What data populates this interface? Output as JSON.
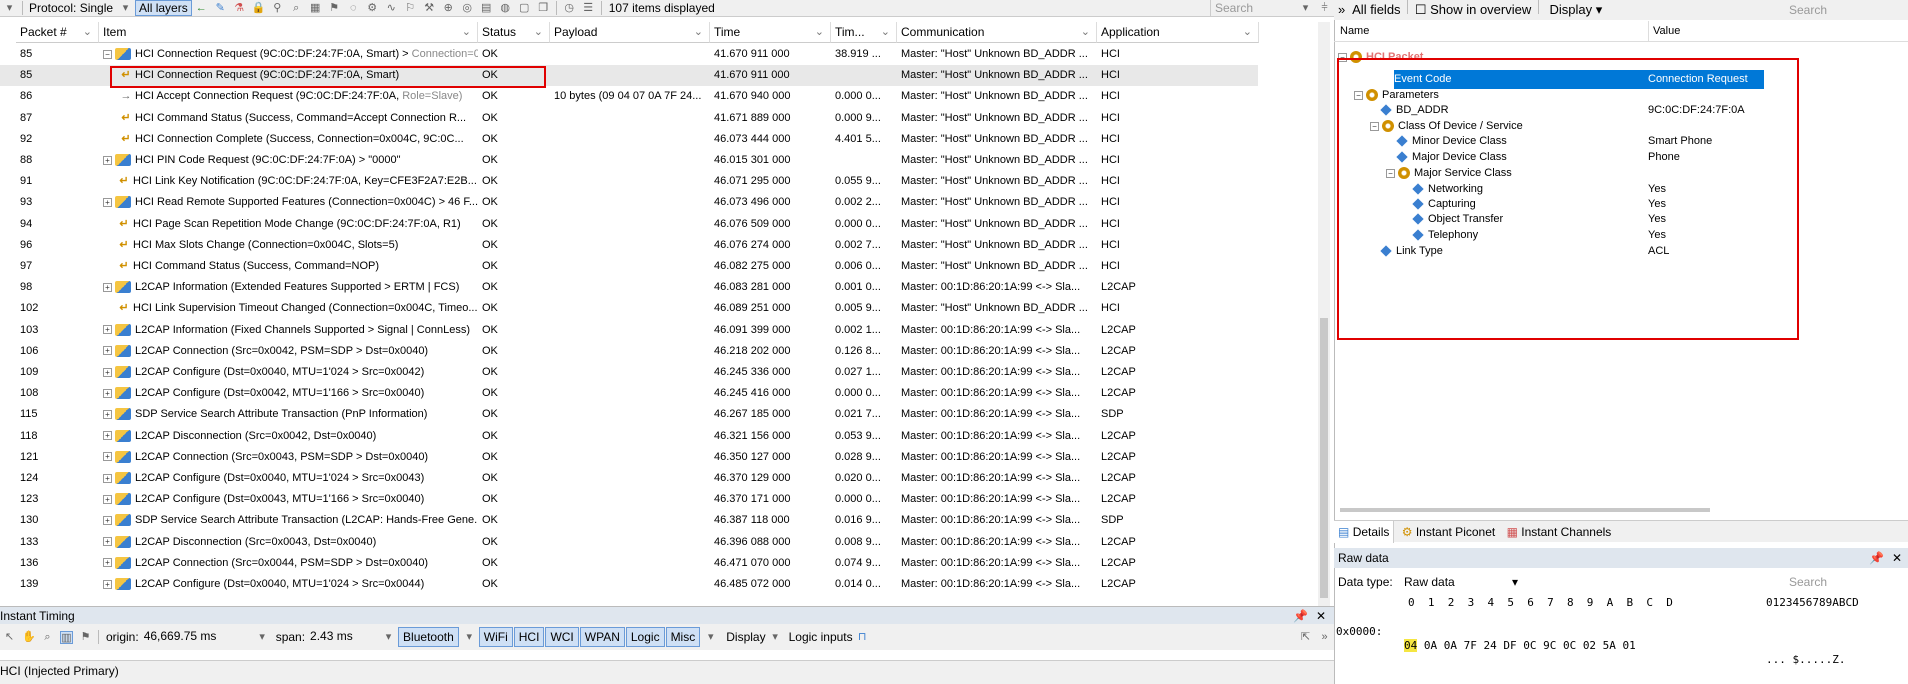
{
  "toolbar": {
    "protocol_label": "Protocol: Single",
    "layers_label": "All layers",
    "items_displayed": "107 items displayed",
    "search_placeholder": "Search"
  },
  "columns": [
    "Packet #",
    "Item",
    "Status",
    "Payload",
    "Time",
    "Tim...",
    "Communication",
    "Application"
  ],
  "rows": [
    {
      "packet": "85",
      "exp": "⊟",
      "icon": "l2",
      "text": "HCI Connection Request (9C:0C:DF:24:7F:0A, Smart) > ",
      "gray": "Connection=0...",
      "status": "OK",
      "payload": "",
      "time": "41.670 911 000",
      "tim": "38.919 ...",
      "comm": "Master: \"Host\" Unknown BD_ADDR ...",
      "app": "HCI",
      "indent": 0
    },
    {
      "packet": "85",
      "exp": "",
      "icon": "rev",
      "text": "HCI Connection Request (9C:0C:DF:24:7F:0A, Smart)",
      "gray": "",
      "status": "OK",
      "payload": "",
      "time": "41.670 911 000",
      "tim": "",
      "comm": "Master: \"Host\" Unknown BD_ADDR ...",
      "app": "HCI",
      "indent": 1
    },
    {
      "packet": "86",
      "exp": "",
      "icon": "fwd",
      "text": "HCI Accept Connection Request (9C:0C:DF:24:7F:0A, ",
      "gray": "Role=Slave)",
      "status": "OK",
      "payload": "10 bytes (09 04 07 0A 7F 24...",
      "time": "41.670 940 000",
      "tim": "0.000 0...",
      "comm": "Master: \"Host\" Unknown BD_ADDR ...",
      "app": "HCI",
      "indent": 1
    },
    {
      "packet": "87",
      "exp": "",
      "icon": "rev",
      "text": "HCI Command Status (Success, Command=Accept Connection R...",
      "gray": "",
      "status": "OK",
      "payload": "",
      "time": "41.671 889 000",
      "tim": "0.000 9...",
      "comm": "Master: \"Host\" Unknown BD_ADDR ...",
      "app": "HCI",
      "indent": 1
    },
    {
      "packet": "92",
      "exp": "",
      "icon": "rev",
      "text": "HCI Connection Complete (Success, Connection=0x004C, 9C:0C...",
      "gray": "",
      "status": "OK",
      "payload": "",
      "time": "46.073 444 000",
      "tim": "4.401 5...",
      "comm": "Master: \"Host\" Unknown BD_ADDR ...",
      "app": "HCI",
      "indent": 1
    },
    {
      "packet": "88",
      "exp": "⊞",
      "icon": "l2",
      "text": "HCI PIN Code Request (9C:0C:DF:24:7F:0A) > \"0000\"",
      "gray": "",
      "status": "OK",
      "payload": "",
      "time": "46.015 301 000",
      "tim": "",
      "comm": "Master: \"Host\" Unknown BD_ADDR ...",
      "app": "HCI",
      "indent": 0
    },
    {
      "packet": "91",
      "exp": "",
      "icon": "rev0",
      "text": "HCI Link Key Notification (9C:0C:DF:24:7F:0A, Key=CFE3F2A7:E2B...",
      "gray": "",
      "status": "OK",
      "payload": "",
      "time": "46.071 295 000",
      "tim": "0.055 9...",
      "comm": "Master: \"Host\" Unknown BD_ADDR ...",
      "app": "HCI",
      "indent": 0
    },
    {
      "packet": "93",
      "exp": "⊞",
      "icon": "l2",
      "text": "HCI Read Remote Supported Features (Connection=0x004C) > 46 F...",
      "gray": "",
      "status": "OK",
      "payload": "",
      "time": "46.073 496 000",
      "tim": "0.002 2...",
      "comm": "Master: \"Host\" Unknown BD_ADDR ...",
      "app": "HCI",
      "indent": 0
    },
    {
      "packet": "94",
      "exp": "",
      "icon": "rev0",
      "text": "HCI Page Scan Repetition Mode Change (9C:0C:DF:24:7F:0A, R1)",
      "gray": "",
      "status": "OK",
      "payload": "",
      "time": "46.076 509 000",
      "tim": "0.000 0...",
      "comm": "Master: \"Host\" Unknown BD_ADDR ...",
      "app": "HCI",
      "indent": 0
    },
    {
      "packet": "96",
      "exp": "",
      "icon": "rev0",
      "text": "HCI Max Slots Change (Connection=0x004C, Slots=5)",
      "gray": "",
      "status": "OK",
      "payload": "",
      "time": "46.076 274 000",
      "tim": "0.002 7...",
      "comm": "Master: \"Host\" Unknown BD_ADDR ...",
      "app": "HCI",
      "indent": 0
    },
    {
      "packet": "97",
      "exp": "",
      "icon": "rev0",
      "text": "HCI Command Status (Success, Command=NOP)",
      "gray": "",
      "status": "OK",
      "payload": "",
      "time": "46.082 275 000",
      "tim": "0.006 0...",
      "comm": "Master: \"Host\" Unknown BD_ADDR ...",
      "app": "HCI",
      "indent": 0
    },
    {
      "packet": "98",
      "exp": "⊞",
      "icon": "l2",
      "text": "L2CAP Information (Extended Features Supported > ERTM | FCS)",
      "gray": "",
      "status": "OK",
      "payload": "",
      "time": "46.083 281 000",
      "tim": "0.001 0...",
      "comm": "Master: 00:1D:86:20:1A:99 <-> Sla...",
      "app": "L2CAP",
      "indent": 0
    },
    {
      "packet": "102",
      "exp": "",
      "icon": "rev0",
      "text": "HCI Link Supervision Timeout Changed (Connection=0x004C, Timeo...",
      "gray": "",
      "status": "OK",
      "payload": "",
      "time": "46.089 251 000",
      "tim": "0.005 9...",
      "comm": "Master: \"Host\" Unknown BD_ADDR ...",
      "app": "HCI",
      "indent": 0
    },
    {
      "packet": "103",
      "exp": "⊞",
      "icon": "l2",
      "text": "L2CAP Information (Fixed Channels Supported > Signal | ConnLess)",
      "gray": "",
      "status": "OK",
      "payload": "",
      "time": "46.091 399 000",
      "tim": "0.002 1...",
      "comm": "Master: 00:1D:86:20:1A:99 <-> Sla...",
      "app": "L2CAP",
      "indent": 0
    },
    {
      "packet": "106",
      "exp": "⊞",
      "icon": "l2",
      "text": "L2CAP Connection (Src=0x0042, PSM=SDP > Dst=0x0040)",
      "gray": "",
      "status": "OK",
      "payload": "",
      "time": "46.218 202 000",
      "tim": "0.126 8...",
      "comm": "Master: 00:1D:86:20:1A:99 <-> Sla...",
      "app": "L2CAP",
      "indent": 0
    },
    {
      "packet": "109",
      "exp": "⊞",
      "icon": "l2",
      "text": "L2CAP Configure (Dst=0x0040, MTU=1'024 > Src=0x0042)",
      "gray": "",
      "status": "OK",
      "payload": "",
      "time": "46.245 336 000",
      "tim": "0.027 1...",
      "comm": "Master: 00:1D:86:20:1A:99 <-> Sla...",
      "app": "L2CAP",
      "indent": 0
    },
    {
      "packet": "108",
      "exp": "⊞",
      "icon": "l2",
      "text": "L2CAP Configure (Dst=0x0042, MTU=1'166 > Src=0x0040)",
      "gray": "",
      "status": "OK",
      "payload": "",
      "time": "46.245 416 000",
      "tim": "0.000 0...",
      "comm": "Master: 00:1D:86:20:1A:99 <-> Sla...",
      "app": "L2CAP",
      "indent": 0
    },
    {
      "packet": "115",
      "exp": "⊞",
      "icon": "l2",
      "text": "SDP Service Search Attribute Transaction (PnP Information)",
      "gray": "",
      "status": "OK",
      "payload": "",
      "time": "46.267 185 000",
      "tim": "0.021 7...",
      "comm": "Master: 00:1D:86:20:1A:99 <-> Sla...",
      "app": "SDP",
      "indent": 0
    },
    {
      "packet": "118",
      "exp": "⊞",
      "icon": "l2",
      "text": "L2CAP Disconnection (Src=0x0042, Dst=0x0040)",
      "gray": "",
      "status": "OK",
      "payload": "",
      "time": "46.321 156 000",
      "tim": "0.053 9...",
      "comm": "Master: 00:1D:86:20:1A:99 <-> Sla...",
      "app": "L2CAP",
      "indent": 0
    },
    {
      "packet": "121",
      "exp": "⊞",
      "icon": "l2",
      "text": "L2CAP Connection (Src=0x0043, PSM=SDP > Dst=0x0040)",
      "gray": "",
      "status": "OK",
      "payload": "",
      "time": "46.350 127 000",
      "tim": "0.028 9...",
      "comm": "Master: 00:1D:86:20:1A:99 <-> Sla...",
      "app": "L2CAP",
      "indent": 0
    },
    {
      "packet": "124",
      "exp": "⊞",
      "icon": "l2",
      "text": "L2CAP Configure (Dst=0x0040, MTU=1'024 > Src=0x0043)",
      "gray": "",
      "status": "OK",
      "payload": "",
      "time": "46.370 129 000",
      "tim": "0.020 0...",
      "comm": "Master: 00:1D:86:20:1A:99 <-> Sla...",
      "app": "L2CAP",
      "indent": 0
    },
    {
      "packet": "123",
      "exp": "⊞",
      "icon": "l2",
      "text": "L2CAP Configure (Dst=0x0043, MTU=1'166 > Src=0x0040)",
      "gray": "",
      "status": "OK",
      "payload": "",
      "time": "46.370 171 000",
      "tim": "0.000 0...",
      "comm": "Master: 00:1D:86:20:1A:99 <-> Sla...",
      "app": "L2CAP",
      "indent": 0
    },
    {
      "packet": "130",
      "exp": "⊞",
      "icon": "l2",
      "text": "SDP Service Search Attribute Transaction (L2CAP: Hands-Free Gene...",
      "gray": "",
      "status": "OK",
      "payload": "",
      "time": "46.387 118 000",
      "tim": "0.016 9...",
      "comm": "Master: 00:1D:86:20:1A:99 <-> Sla...",
      "app": "SDP",
      "indent": 0
    },
    {
      "packet": "133",
      "exp": "⊞",
      "icon": "l2",
      "text": "L2CAP Disconnection (Src=0x0043, Dst=0x0040)",
      "gray": "",
      "status": "OK",
      "payload": "",
      "time": "46.396 088 000",
      "tim": "0.008 9...",
      "comm": "Master: 00:1D:86:20:1A:99 <-> Sla...",
      "app": "L2CAP",
      "indent": 0
    },
    {
      "packet": "136",
      "exp": "⊞",
      "icon": "l2",
      "text": "L2CAP Connection (Src=0x0044, PSM=SDP > Dst=0x0040)",
      "gray": "",
      "status": "OK",
      "payload": "",
      "time": "46.471 070 000",
      "tim": "0.074 9...",
      "comm": "Master: 00:1D:86:20:1A:99 <-> Sla...",
      "app": "L2CAP",
      "indent": 0
    },
    {
      "packet": "139",
      "exp": "⊞",
      "icon": "l2",
      "text": "L2CAP Configure (Dst=0x0040, MTU=1'024 > Src=0x0044)",
      "gray": "",
      "status": "OK",
      "payload": "",
      "time": "46.485 072 000",
      "tim": "0.014 0...",
      "comm": "Master: 00:1D:86:20:1A:99 <-> Sla...",
      "app": "L2CAP",
      "indent": 0
    }
  ],
  "timing": {
    "title": "Instant Timing",
    "origin_label": "origin:",
    "origin_value": "46,669.75 ms",
    "span_label": "span:",
    "span_value": "2.43 ms",
    "tags": [
      "Bluetooth",
      "WiFi",
      "HCI",
      "WCI",
      "WPAN",
      "Logic",
      "Misc"
    ],
    "display_label": "Display",
    "logic_inputs_label": "Logic inputs"
  },
  "status_bar": "HCI (Injected Primary)",
  "right_panel": {
    "all_fields": "All fields",
    "show_overview": "Show in overview",
    "display": "Display",
    "search_placeholder": "Search",
    "col_name": "Name",
    "col_value": "Value",
    "tree": [
      {
        "name": "HCI Packet",
        "value": "",
        "level": 0,
        "kind": "hdr"
      },
      {
        "name": "Event Code",
        "value": "Connection Request",
        "level": 1,
        "kind": "leaf",
        "selected": true
      },
      {
        "name": "Parameters",
        "value": "",
        "level": 1,
        "kind": "group"
      },
      {
        "name": "BD_ADDR",
        "value": "9C:0C:DF:24:7F:0A",
        "level": 2,
        "kind": "leaf"
      },
      {
        "name": "Class Of Device / Service",
        "value": "",
        "level": 2,
        "kind": "group"
      },
      {
        "name": "Minor Device Class",
        "value": "Smart Phone",
        "level": 3,
        "kind": "leaf"
      },
      {
        "name": "Major Device Class",
        "value": "Phone",
        "level": 3,
        "kind": "leaf"
      },
      {
        "name": "Major Service Class",
        "value": "",
        "level": 3,
        "kind": "group"
      },
      {
        "name": "Networking",
        "value": "Yes",
        "level": 4,
        "kind": "leaf"
      },
      {
        "name": "Capturing",
        "value": "Yes",
        "level": 4,
        "kind": "leaf"
      },
      {
        "name": "Object Transfer",
        "value": "Yes",
        "level": 4,
        "kind": "leaf"
      },
      {
        "name": "Telephony",
        "value": "Yes",
        "level": 4,
        "kind": "leaf"
      },
      {
        "name": "Link Type",
        "value": "ACL",
        "level": 2,
        "kind": "leaf"
      }
    ],
    "tabs": [
      "Details",
      "Instant Piconet",
      "Instant Channels"
    ],
    "raw_title": "Raw data",
    "data_type_label": "Data type:",
    "data_type_value": "Raw data",
    "raw_search": "Search",
    "hex_header": "0  1  2  3  4  5  6  7  8  9  A  B  C  D",
    "ascii_header": "0123456789ABCD",
    "hex_offset": "0x0000:",
    "hex_first": "04",
    "hex_rest": " 0A 0A 7F 24 DF 0C 9C 0C 02 5A 01",
    "ascii_row": "... $.....Z."
  }
}
